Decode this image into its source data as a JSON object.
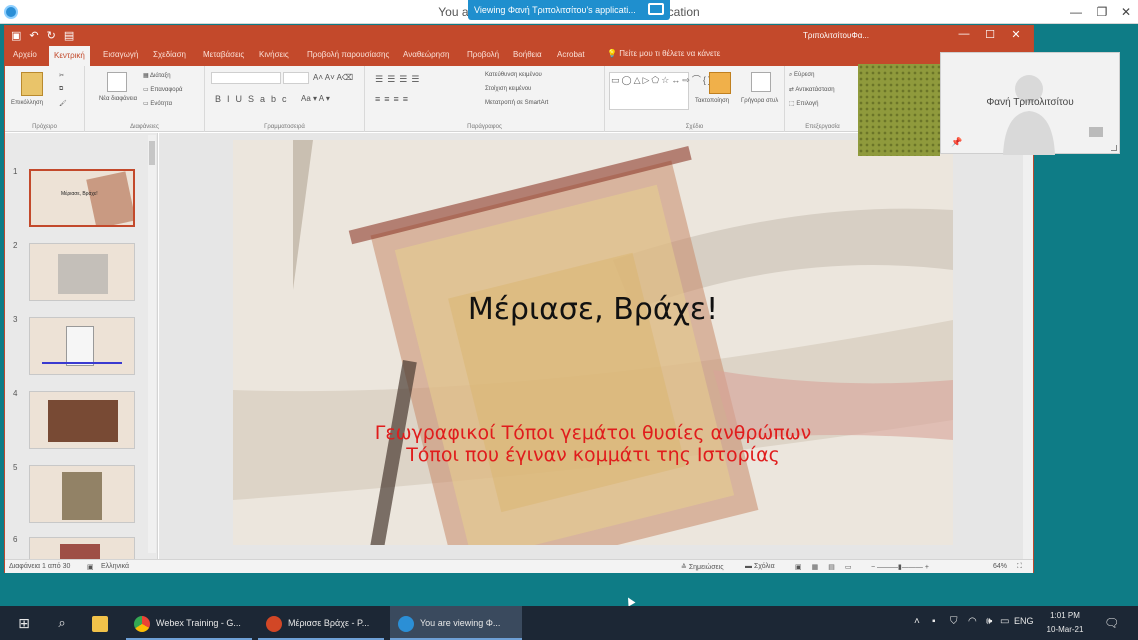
{
  "viewer": {
    "title": "You are viewing Φανή Τριπολιτσίτου's application",
    "share_banner": "Viewing Φανή Τριπολιτσίτου's applicati..."
  },
  "powerpoint": {
    "doc_title": "ΤριπολιτσίτουΦα...",
    "tabs": [
      "Αρχείο",
      "Κεντρική",
      "Εισαγωγή",
      "Σχεδίαση",
      "Μεταβάσεις",
      "Κινήσεις",
      "Προβολή παρουσίασης",
      "Αναθεώρηση",
      "Προβολή",
      "Βοήθεια",
      "Acrobat"
    ],
    "active_tab": "Κεντρική",
    "tell_me": "Πείτε μου τι θέλετε να κάνετε",
    "ribbon_groups": [
      "Πρόχειρο",
      "Διαφάνειες",
      "Γραμματοσειρά",
      "Παράγραφος",
      "Σχέδιο",
      "Επεξεργασία"
    ],
    "ribbon_buttons": {
      "paste": "Επικόλληση",
      "new_slide": "Νέα διαφάνεια",
      "layout": "Διάταξη",
      "reset": "Επαναφορά",
      "section": "Ενότητα",
      "arrange": "Τακτοποίηση",
      "quick_styles": "Γρήγορα στυλ",
      "find": "Εύρεση",
      "replace": "Αντικατάσταση",
      "select": "Επιλογή",
      "text_direction": "Κατεύθυνση κειμένου",
      "align_text": "Στοίχιση κειμένου",
      "smartart": "Μετατροπή σε SmartArt"
    },
    "slide_numbers": [
      "1",
      "2",
      "3",
      "4",
      "5",
      "6"
    ],
    "selected_slide": 1,
    "slide": {
      "title": "Μέριασε, Βράχε!",
      "subtitle_line1": "Γεωγραφικοί Τόποι γεμάτοι θυσίες ανθρώπων",
      "subtitle_line2": "Τόποι που έγιναν κομμάτι της Ιστορίας"
    },
    "thumb_title": "Μέριασε, Βράχε!",
    "status": {
      "slide_info": "Διαφάνεια 1 από 30",
      "language": "Ελληνικά",
      "notes": "Σημειώσεις",
      "comments": "Σχόλια",
      "zoom": "64%"
    }
  },
  "video": {
    "participant_name": "Φανή Τριπολιτσίτου"
  },
  "taskbar": {
    "items": [
      "Webex Training - G...",
      "Μέριασε Βράχε - P...",
      "You are viewing Φ..."
    ],
    "language": "ENG",
    "time": "1:01 PM",
    "date": "10-Mar-21"
  },
  "colors": {
    "ppt_accent": "#c3492b",
    "subtitle_red": "#e01c1c",
    "desktop": "#0e7c86",
    "taskbar": "#1c2735"
  }
}
